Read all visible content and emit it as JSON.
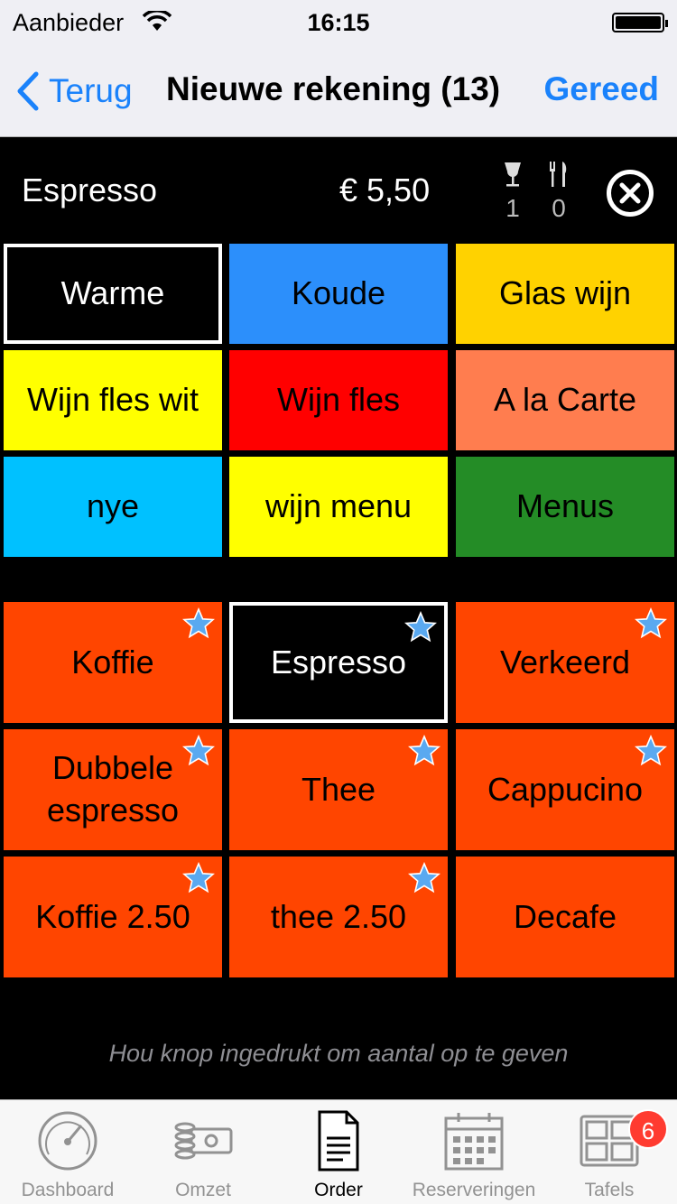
{
  "status_bar": {
    "carrier": "Aanbieder",
    "time": "16:15"
  },
  "nav": {
    "back_label": "Terug",
    "title": "Nieuwe rekening (13)",
    "done_label": "Gereed"
  },
  "order_line": {
    "item": "Espresso",
    "price": "€ 5,50",
    "drinks_count": "1",
    "food_count": "0"
  },
  "categories": [
    {
      "label": "Warme",
      "color": "#000000",
      "selected": true
    },
    {
      "label": "Koude",
      "color": "#2c8ffb"
    },
    {
      "label": "Glas wijn",
      "color": "#ffd200"
    },
    {
      "label": "Wijn fles wit",
      "color": "#ffff00"
    },
    {
      "label": "Wijn fles",
      "color": "#ff0000"
    },
    {
      "label": "A la Carte",
      "color": "#ff7d4f"
    },
    {
      "label": "nye",
      "color": "#00c1ff"
    },
    {
      "label": "wijn menu",
      "color": "#ffff00"
    },
    {
      "label": "Menus",
      "color": "#248c26"
    }
  ],
  "items": [
    {
      "label": "Koffie",
      "favorite": true
    },
    {
      "label": "Espresso",
      "favorite": true,
      "selected": true
    },
    {
      "label": "Verkeerd",
      "favorite": true
    },
    {
      "label": "Dubbele espresso",
      "favorite": true
    },
    {
      "label": "Thee",
      "favorite": true
    },
    {
      "label": "Cappucino",
      "favorite": true
    },
    {
      "label": "Koffie 2.50",
      "favorite": true
    },
    {
      "label": "thee 2.50",
      "favorite": true
    },
    {
      "label": "Decafe",
      "favorite": false
    }
  ],
  "item_color": "#ff4500",
  "hint": "Hou knop ingedrukt om aantal op te geven",
  "tabs": [
    {
      "label": "Dashboard",
      "icon": "dashboard-gauge-icon"
    },
    {
      "label": "Omzet",
      "icon": "coins-banknote-icon"
    },
    {
      "label": "Order",
      "icon": "document-icon",
      "active": true
    },
    {
      "label": "Reserveringen",
      "icon": "calendar-icon"
    },
    {
      "label": "Tafels",
      "icon": "tables-grid-icon",
      "badge": "6"
    }
  ]
}
